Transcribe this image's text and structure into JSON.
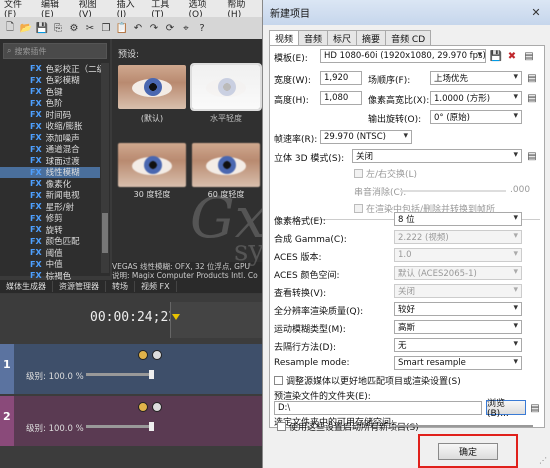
{
  "vegas": {
    "menu": [
      "文件(F)",
      "编辑(E)",
      "视图(V)",
      "插入(I)",
      "工具(T)",
      "选项(O)",
      "帮助(H)"
    ],
    "fx_search_placeholder": "搜索插件",
    "fx_prefix": "FX",
    "fx_items": [
      "色彩校正（二级）",
      "色彩模糊",
      "色键",
      "色阶",
      "时间码",
      "收缩/膨胀",
      "添加噪声",
      "通道混合",
      "球面过渡",
      "线性模糊",
      "像素化",
      "新闻电视",
      "星形/射",
      "修剪",
      "旋转",
      "颜色匹配",
      "阈值",
      "中值",
      "棕褐色",
      "最小和最大"
    ],
    "fx_selected_index": 9,
    "preset_label": "预设:",
    "thumbs": [
      "(默认)",
      "水平轻度",
      "30 度轻度",
      "60 度轻度"
    ],
    "status_line1": "VEGAS 线性模糊: OFX, 32 位浮点, GPU",
    "status_line2": "说明: Magix Computer Products Intl. Co",
    "bottom_tabs": [
      "媒体生成器",
      "资源管理器",
      "转场",
      "视频 FX"
    ],
    "timecode": "00:00:24;23",
    "tracks": [
      {
        "num": "1",
        "level": "级别: 100.0 %"
      },
      {
        "num": "2",
        "level": "级别: 100.0 %"
      }
    ]
  },
  "dialog": {
    "title": "新建项目",
    "close_glyph": "✕",
    "tabs": [
      "视频",
      "音频",
      "标尺",
      "摘要",
      "音频 CD"
    ],
    "active_tab": 0,
    "template_label": "模板(E):",
    "template_value": "HD 1080-60i (1920x1080, 29.970 fps)",
    "width_label": "宽度(W):",
    "width_value": "1,920",
    "field_order_label": "场顺序(F):",
    "field_order_value": "上场优先",
    "height_label": "高度(H):",
    "height_value": "1,080",
    "pixel_aspect_label": "像素高宽比(X):",
    "pixel_aspect_value": "1.0000 (方形)",
    "rotation_label": "输出旋转(O):",
    "rotation_value": "0° (原始)",
    "fps_label": "帧速率(R):",
    "fps_value": "29.970 (NTSC)",
    "stereo_label": "立体 3D 模式(S):",
    "stereo_value": "关闭",
    "swap_lr_label": "左/右交换(L)",
    "crosstalk_label": "串音消除(C):",
    "crosstalk_value": ".000",
    "include_stereo_label": "在渲染中包括/删除并转换到帧所",
    "pixel_format_label": "像素格式(E):",
    "pixel_format_value": "8 位",
    "gamma_label": "合成 Gamma(C):",
    "gamma_value": "2.222 (视频)",
    "aces_version_label": "ACES 版本:",
    "aces_version_value": "1.0",
    "aces_space_label": "ACES 颜色空间:",
    "aces_space_value": "默认 (ACES2065-1)",
    "view_transform_label": "查看转换(V):",
    "view_transform_value": "关闭",
    "quality_label": "全分辨率渲染质量(Q):",
    "quality_value": "较好",
    "motion_blur_label": "运动模糊类型(M):",
    "motion_blur_value": "高斯",
    "deinterlace_label": "去隔行方法(D):",
    "deinterlace_value": "无",
    "resample_label": "Resample mode:",
    "resample_value": "Smart resample",
    "adjust_source_label": "调整源媒体以更好地匹配项目或渲染设置(S)",
    "prerender_folder_label": "预渲染文件的文件夹(E):",
    "prerender_folder_value": "D:\\",
    "browse_label": "浏览(B)...",
    "free_space_label": "选定文件夹中的可用存储空间:",
    "start_all_label": "使用这些设置启动所有新项目(S)",
    "ok_label": "确定"
  },
  "watermark": {
    "big": "Gx",
    "small": "system"
  }
}
